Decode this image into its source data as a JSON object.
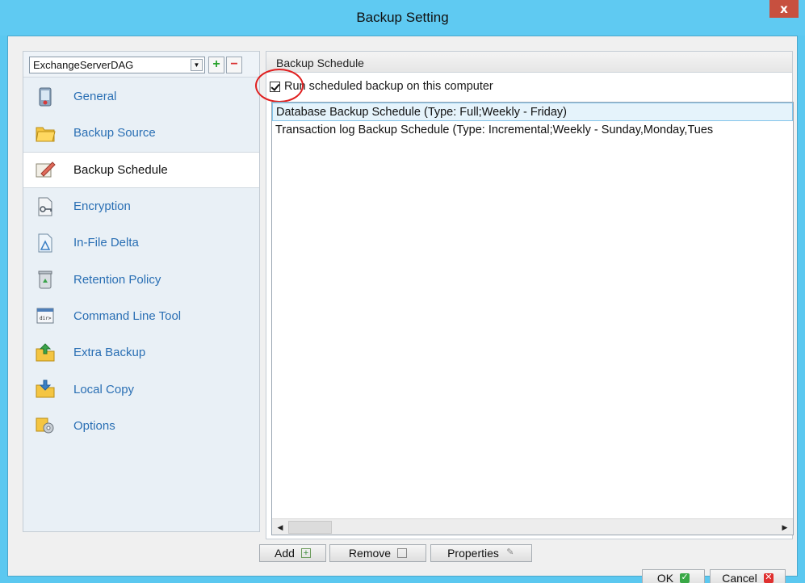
{
  "window": {
    "title": "Backup Setting",
    "close_label": "x"
  },
  "sidebar": {
    "profile": "ExchangeServerDAG",
    "add_label": "+",
    "remove_label": "−",
    "items": [
      {
        "label": "General",
        "icon": "general-icon"
      },
      {
        "label": "Backup Source",
        "icon": "folder-icon"
      },
      {
        "label": "Backup Schedule",
        "icon": "schedule-icon"
      },
      {
        "label": "Encryption",
        "icon": "encryption-icon"
      },
      {
        "label": "In-File Delta",
        "icon": "delta-icon"
      },
      {
        "label": "Retention Policy",
        "icon": "recycle-bin-icon"
      },
      {
        "label": "Command Line Tool",
        "icon": "command-line-icon"
      },
      {
        "label": "Extra Backup",
        "icon": "extra-backup-icon"
      },
      {
        "label": "Local Copy",
        "icon": "local-copy-icon"
      },
      {
        "label": "Options",
        "icon": "options-icon"
      }
    ],
    "active_index": 2
  },
  "main": {
    "section_title": "Backup Schedule",
    "run_scheduled_label": "Run scheduled backup on this computer",
    "run_scheduled_checked": true,
    "schedules": [
      "Database Backup Schedule (Type: Full;Weekly - Friday)",
      "Transaction log Backup Schedule (Type: Incremental;Weekly - Sunday,Monday,Tues"
    ],
    "buttons": {
      "add": "Add",
      "remove": "Remove",
      "properties": "Properties"
    }
  },
  "footer": {
    "ok": "OK",
    "cancel": "Cancel"
  },
  "colors": {
    "titlebar": "#5fcaf2",
    "link": "#2a6fb4",
    "highlight_ring": "#e02020"
  }
}
